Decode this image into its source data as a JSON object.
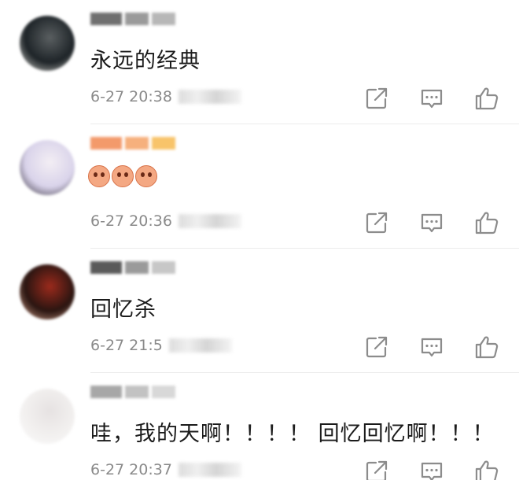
{
  "comments": [
    {
      "text": "永远的经典",
      "time": "6-27 20:38",
      "has_emoji": false,
      "avatar_colors": [
        "#1e2428",
        "#5a5f61",
        "#d7d6d0"
      ],
      "name_colors": [
        "#6f6f6f",
        "#9a9a9a",
        "#b7b7b7"
      ]
    },
    {
      "text": "",
      "time": "6-27 20:36",
      "has_emoji": true,
      "emoji_count": 3,
      "avatar_colors": [
        "#d9d3ea",
        "#f3eef4",
        "#2a2430"
      ],
      "name_colors": [
        "#f39a6b",
        "#f6b07d",
        "#f8c46a"
      ]
    },
    {
      "text": "回忆杀",
      "time": "6-27 21:5",
      "has_emoji": false,
      "avatar_colors": [
        "#2a1511",
        "#9b2a1c",
        "#d9a58d"
      ],
      "name_colors": [
        "#5a5a5a",
        "#9a9a9a",
        "#c7c7c7"
      ]
    },
    {
      "text": "哇，我的天啊！！！！ 回忆回忆啊！！！",
      "time": "6-27 20:37",
      "has_emoji": false,
      "avatar_colors": [
        "#f2f0ef",
        "#e6e2e2",
        "#fbfbfb"
      ],
      "name_colors": [
        "#a7a7a7",
        "#c2c2c2",
        "#d8d8d8"
      ]
    }
  ],
  "icons": {
    "share": "share-icon",
    "reply": "comment-icon",
    "like": "thumbs-up-icon"
  },
  "colors": {
    "icon": "#8c8c8c",
    "meta_text": "#8a8a8a",
    "body_text": "#1b1b1b"
  }
}
